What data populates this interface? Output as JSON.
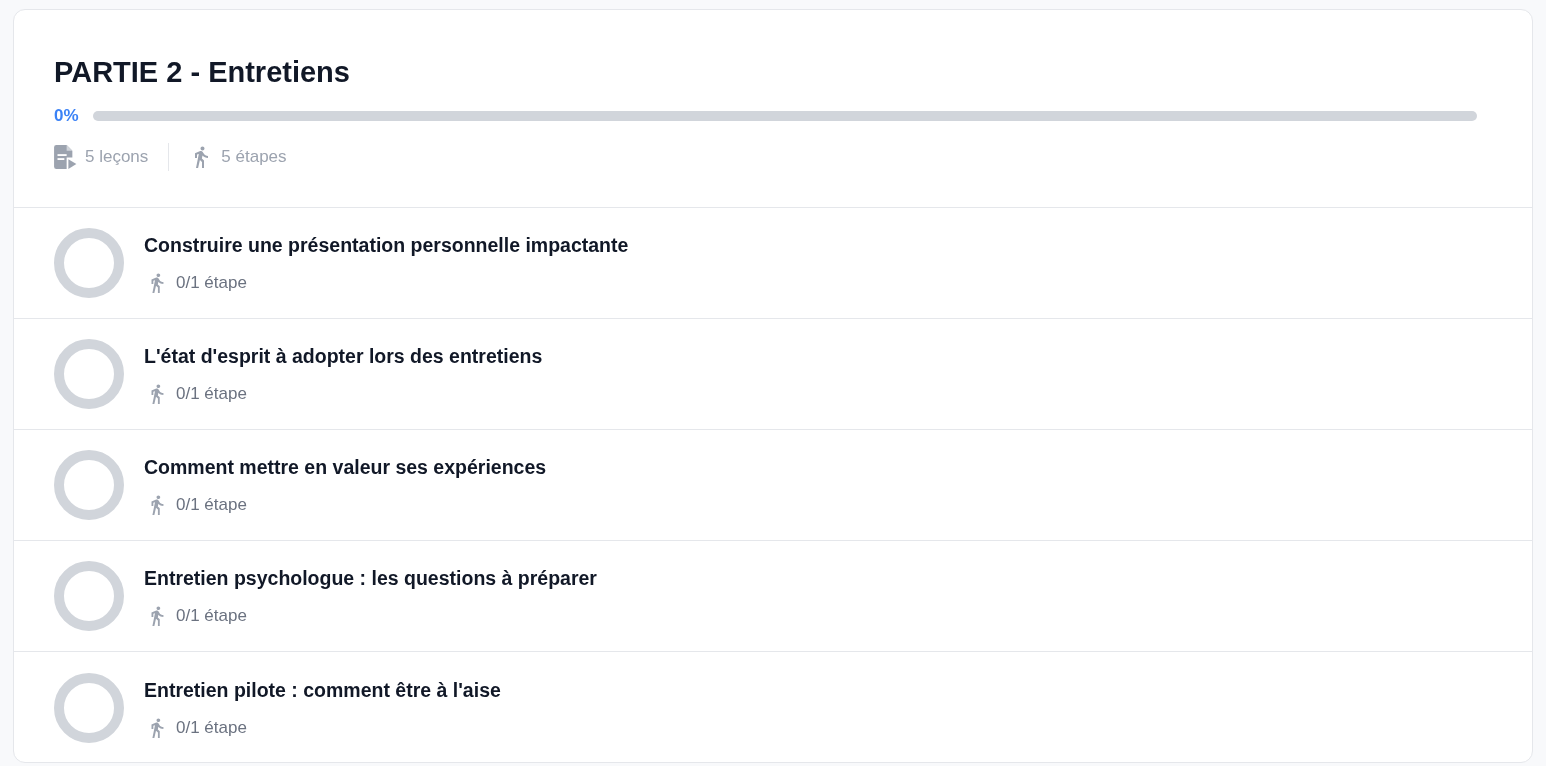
{
  "section": {
    "title": "PARTIE 2 - Entretiens",
    "progress": {
      "reading": "0%",
      "level": 0
    },
    "stats": [
      {
        "kind": "lessons",
        "label": "5 leçons"
      },
      {
        "kind": "steps",
        "label": "5 étapes"
      }
    ]
  },
  "lessons": [
    {
      "title": "Construire une présentation personnelle impactante",
      "steps": "0/1 étape",
      "level": 0
    },
    {
      "title": "L'état d'esprit à adopter lors des entretiens",
      "steps": "0/1 étape",
      "level": 0
    },
    {
      "title": "Comment mettre en valeur ses expériences",
      "steps": "0/1 étape",
      "level": 0
    },
    {
      "title": "Entretien psychologue : les questions à préparer",
      "steps": "0/1 étape",
      "level": 0
    },
    {
      "title": "Entretien pilote : comment être à l'aise",
      "steps": "0/1 étape",
      "level": 0
    }
  ]
}
